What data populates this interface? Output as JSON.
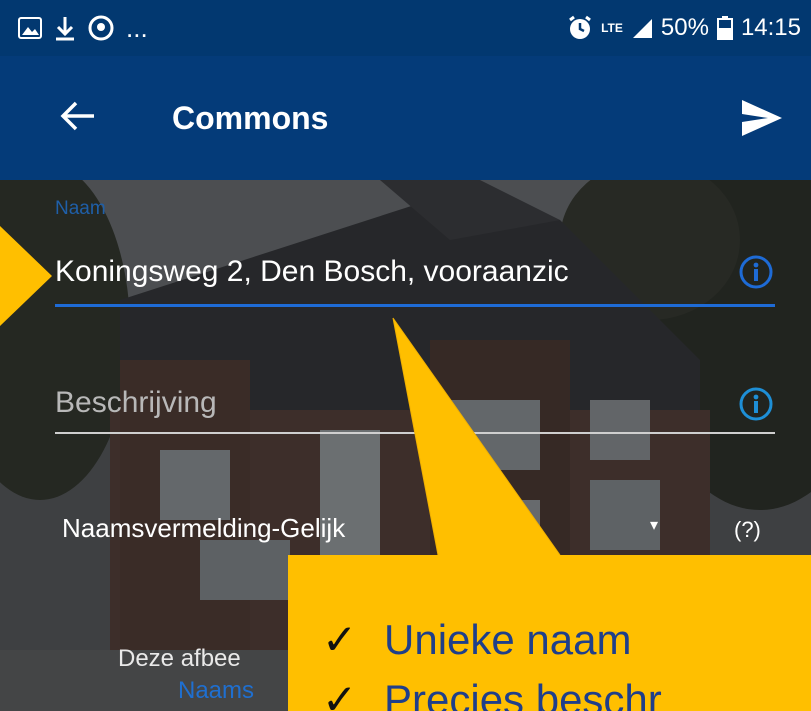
{
  "status_bar": {
    "left_icons": [
      "image-icon",
      "download-icon",
      "face-icon"
    ],
    "left_more": "...",
    "network": "LTE",
    "battery": "50%",
    "time": "14:15"
  },
  "app_bar": {
    "title": "Commons"
  },
  "form": {
    "name_label": "Naam",
    "name_value": "Koningsweg 2, Den Bosch, vooraanzic",
    "description_placeholder": "Beschrijving",
    "license_text": "Naamsvermelding-Gelijk",
    "license_help": "(?)",
    "notice_text": "Deze afbee",
    "notice_link": "Naams"
  },
  "callout": {
    "items": [
      "Unieke naam",
      "Precies beschr"
    ]
  },
  "colors": {
    "app_bar": "#043b79",
    "status_bar": "#023870",
    "callout": "#ffbf00",
    "underline_active": "#1e6bd6"
  }
}
